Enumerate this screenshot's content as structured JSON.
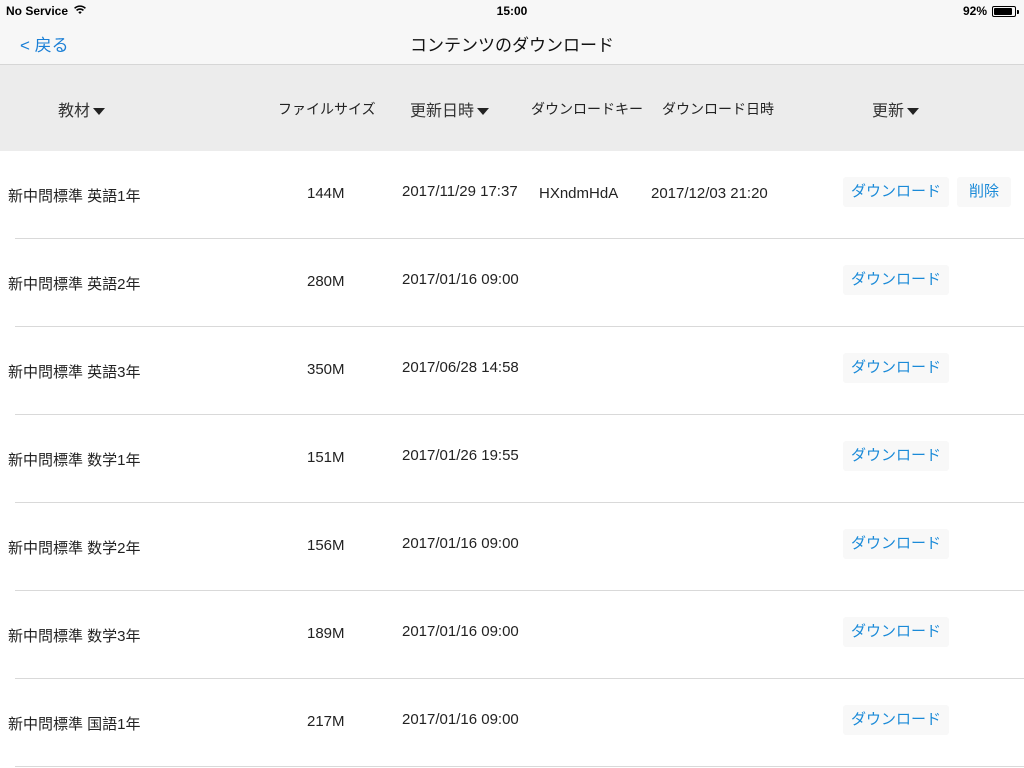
{
  "status_bar": {
    "carrier": "No Service",
    "time": "15:00",
    "battery_text": "92%",
    "battery_level": 0.92
  },
  "nav": {
    "back_label": "< 戻る",
    "title": "コンテンツのダウンロード"
  },
  "header": {
    "col_title": "教材",
    "col_size": "ファイルサイズ",
    "col_updated": "更新日時",
    "col_key": "ダウンロードキー",
    "col_dl_date": "ダウンロード日時",
    "col_update": "更新"
  },
  "rows": [
    {
      "title": "新中問標準 英語1年",
      "size": "144M",
      "updated": "2017/11/29 17:37",
      "key": "HXndmHdA",
      "dl_date": "2017/12/03 21:20",
      "download_label": "ダウンロード",
      "delete_label": "削除"
    },
    {
      "title": "新中問標準 英語2年",
      "size": "280M",
      "updated": "2017/01/16 09:00",
      "download_label": "ダウンロード"
    },
    {
      "title": "新中問標準 英語3年",
      "size": "350M",
      "updated": "2017/06/28 14:58",
      "download_label": "ダウンロード"
    },
    {
      "title": "新中問標準 数学1年",
      "size": "151M",
      "updated": "2017/01/26 19:55",
      "download_label": "ダウンロード"
    },
    {
      "title": "新中問標準 数学2年",
      "size": "156M",
      "updated": "2017/01/16 09:00",
      "download_label": "ダウンロード"
    },
    {
      "title": "新中問標準 数学3年",
      "size": "189M",
      "updated": "2017/01/16 09:00",
      "download_label": "ダウンロード"
    },
    {
      "title": "新中問標準 国語1年",
      "size": "217M",
      "updated": "2017/01/16 09:00",
      "download_label": "ダウンロード"
    }
  ],
  "colors": {
    "accent": "#1a8ad8",
    "header_bg": "#ececec",
    "bar_bg": "#f7f7f7"
  }
}
